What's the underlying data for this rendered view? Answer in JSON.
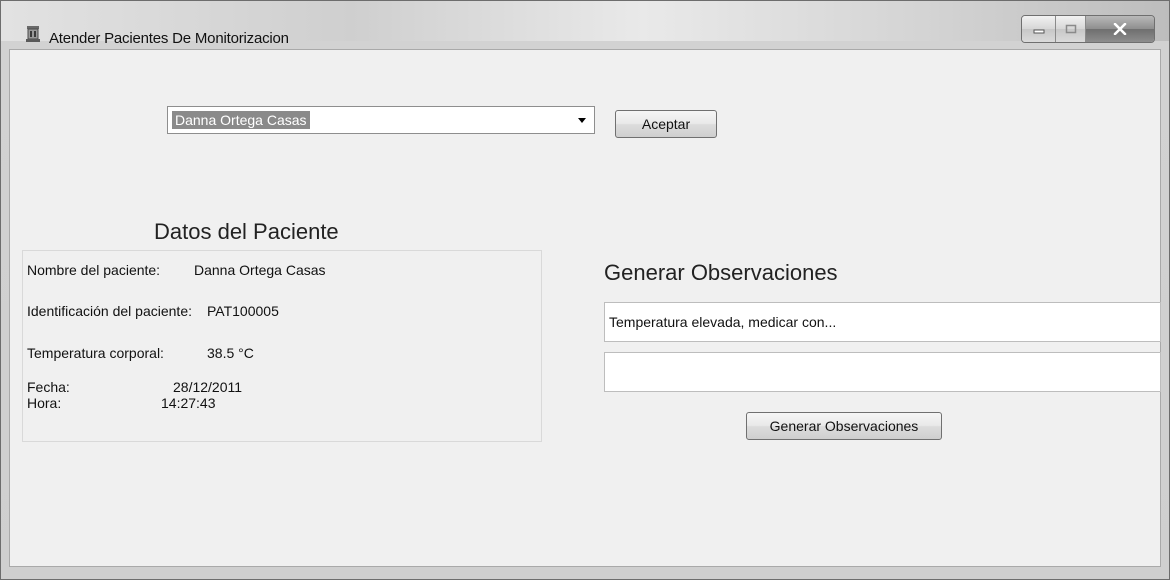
{
  "window": {
    "title": "Atender Pacientes De Monitorizacion"
  },
  "patient_select": {
    "selected": "Danna Ortega Casas",
    "accept_label": "Aceptar"
  },
  "patient_data": {
    "section_title": "Datos del Paciente",
    "name_label": "Nombre del paciente:",
    "name_value": "Danna Ortega Casas",
    "id_label": "Identificación del paciente:",
    "id_value": "PAT100005",
    "temp_label": "Temperatura corporal:",
    "temp_value": "38.5 °C",
    "date_label": "Fecha:",
    "date_value": "28/12/2011",
    "time_label": "Hora:",
    "time_value": "14:27:43"
  },
  "observations": {
    "section_title": "Generar Observaciones",
    "field1_value": "Temperatura elevada, medicar con...",
    "field2_value": "",
    "generate_label": "Generar Observaciones"
  },
  "colors": {
    "client_bg": "#f0f0f0",
    "selection_bg": "#8a8a8a",
    "close_button": "#8d8d8d"
  }
}
